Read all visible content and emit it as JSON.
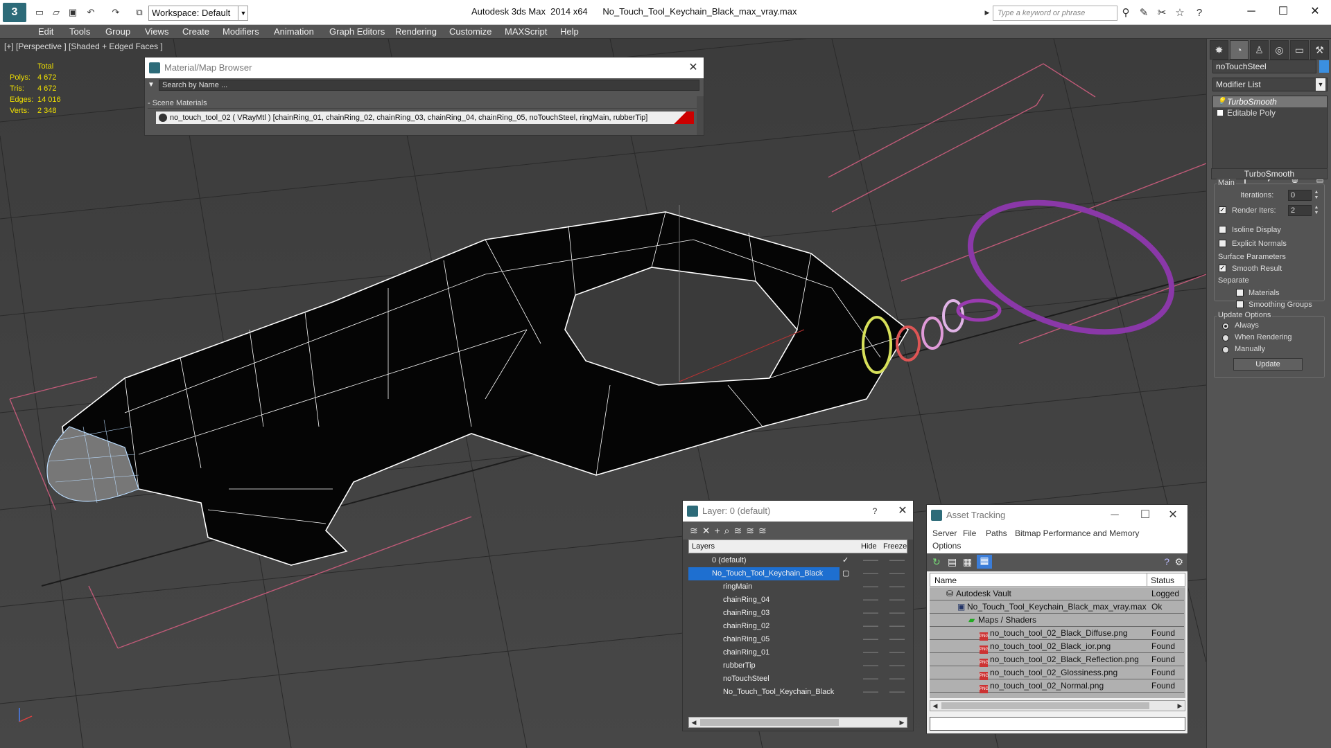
{
  "titlebar": {
    "workspace": "Workspace: Default",
    "window_title": "Autodesk 3ds Max  2014 x64      No_Touch_Tool_Keychain_Black_max_vray.max",
    "search_placeholder": "Type a keyword or phrase"
  },
  "menu": [
    "Edit",
    "Tools",
    "Group",
    "Views",
    "Create",
    "Modifiers",
    "Animation",
    "Graph Editors",
    "Rendering",
    "Customize",
    "MAXScript",
    "Help"
  ],
  "viewport": {
    "label": "[+] [Perspective ] [Shaded + Edged Faces ]",
    "stats": {
      "header": "Total",
      "rows": [
        {
          "k": "Polys:",
          "v": "4 672"
        },
        {
          "k": "Tris:",
          "v": "4 672"
        },
        {
          "k": "Edges:",
          "v": "14 016"
        },
        {
          "k": "Verts:",
          "v": "2 348"
        }
      ]
    }
  },
  "material_browser": {
    "title": "Material/Map Browser",
    "search": "Search by Name ...",
    "section": "- Scene Materials",
    "item": "no_touch_tool_02  ( VRayMtl )  [chainRing_01, chainRing_02, chainRing_03, chainRing_04, chainRing_05, noTouchSteel, ringMain, rubberTip]"
  },
  "command_panel": {
    "object_name": "noTouchSteel",
    "modifier_list": "Modifier List",
    "stack": [
      "TurboSmooth",
      "Editable Poly"
    ],
    "rollout": "TurboSmooth",
    "main_label": "Main",
    "iterations_label": "Iterations:",
    "iterations": "0",
    "render_iters_label": "Render Iters:",
    "render_iters": "2",
    "isoline": "Isoline Display",
    "explicit": "Explicit Normals",
    "surface_params": "Surface Parameters",
    "smooth_result": "Smooth Result",
    "separate": "Separate",
    "materials": "Materials",
    "smoothing_groups": "Smoothing Groups",
    "update_options": "Update Options",
    "always": "Always",
    "when_rendering": "When Rendering",
    "manually": "Manually",
    "update_btn": "Update"
  },
  "layer_dialog": {
    "title": "Layer: 0 (default)",
    "col_layers": "Layers",
    "col_hide": "Hide",
    "col_freeze": "Freeze",
    "rows": [
      {
        "name": "0 (default)",
        "indent": 0
      },
      {
        "name": "No_Touch_Tool_Keychain_Black",
        "indent": 0
      },
      {
        "name": "ringMain",
        "indent": 1
      },
      {
        "name": "chainRing_04",
        "indent": 1
      },
      {
        "name": "chainRing_03",
        "indent": 1
      },
      {
        "name": "chainRing_02",
        "indent": 1
      },
      {
        "name": "chainRing_05",
        "indent": 1
      },
      {
        "name": "chainRing_01",
        "indent": 1
      },
      {
        "name": "rubberTip",
        "indent": 1
      },
      {
        "name": "noTouchSteel",
        "indent": 1
      },
      {
        "name": "No_Touch_Tool_Keychain_Black",
        "indent": 1
      }
    ]
  },
  "asset_tracking": {
    "title": "Asset Tracking",
    "menu": [
      "Server",
      "File",
      "Paths",
      "Bitmap Performance and Memory",
      "Options"
    ],
    "col_name": "Name",
    "col_status": "Status",
    "rows": [
      {
        "name": "Autodesk Vault",
        "status": "Logged"
      },
      {
        "name": "No_Touch_Tool_Keychain_Black_max_vray.max",
        "status": "Ok"
      },
      {
        "name": "Maps / Shaders",
        "status": ""
      },
      {
        "name": "no_touch_tool_02_Black_Diffuse.png",
        "status": "Found"
      },
      {
        "name": "no_touch_tool_02_Black_ior.png",
        "status": "Found"
      },
      {
        "name": "no_touch_tool_02_Black_Reflection.png",
        "status": "Found"
      },
      {
        "name": "no_touch_tool_02_Glossiness.png",
        "status": "Found"
      },
      {
        "name": "no_touch_tool_02_Normal.png",
        "status": "Found"
      }
    ]
  }
}
